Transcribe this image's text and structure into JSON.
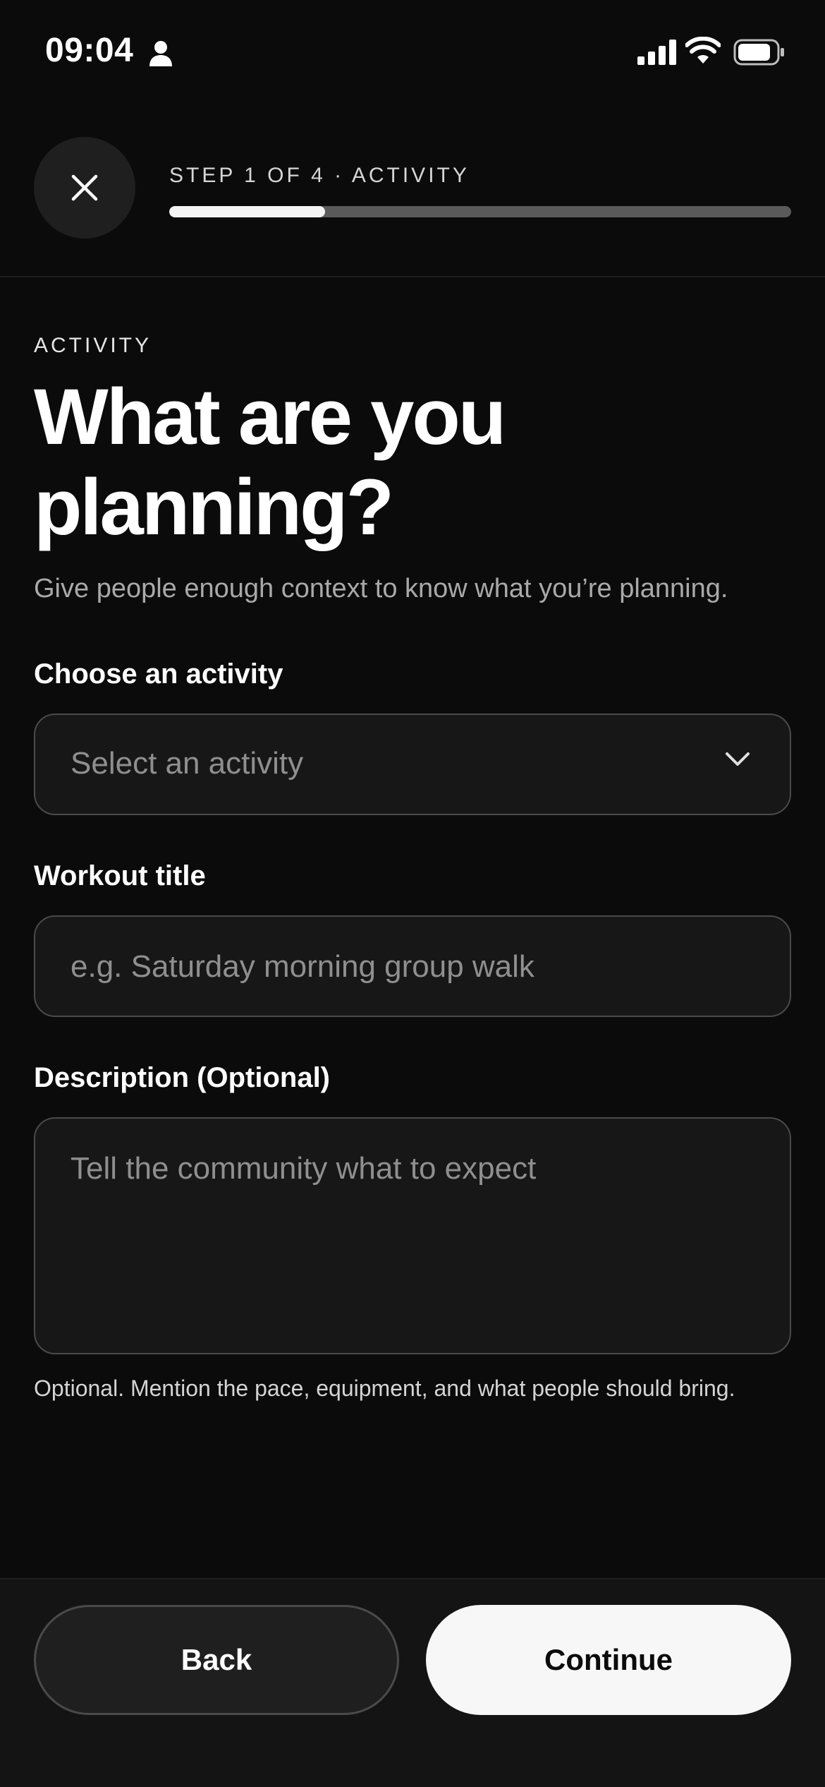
{
  "status_bar": {
    "time": "09:04",
    "icons": [
      "person-icon",
      "signal-icon",
      "wifi-icon",
      "battery-icon"
    ]
  },
  "header": {
    "step_label": "STEP 1 OF 4 · ACTIVITY",
    "progress_fraction": 0.25,
    "close_icon": "close-icon"
  },
  "main": {
    "eyebrow": "ACTIVITY",
    "title": "What are you planning?",
    "subtitle": "Give people enough context to know what you’re planning.",
    "activity": {
      "label": "Choose an activity",
      "placeholder": "Select an activity",
      "icon": "chevron-down-icon"
    },
    "workout_title": {
      "label": "Workout title",
      "placeholder": "e.g. Saturday morning group walk"
    },
    "description": {
      "label": "Description (Optional)",
      "placeholder": "Tell the community what to expect",
      "helper": "Optional. Mention the pace, equipment, and what people should bring."
    }
  },
  "footer": {
    "back_label": "Back",
    "continue_label": "Continue"
  },
  "colors": {
    "background": "#0b0b0b",
    "field_background": "#171717",
    "field_border": "#4a4a4a",
    "progress_track": "#5a5a5a",
    "progress_fill": "#f4f4f4",
    "primary_button": "#f7f7f7"
  }
}
